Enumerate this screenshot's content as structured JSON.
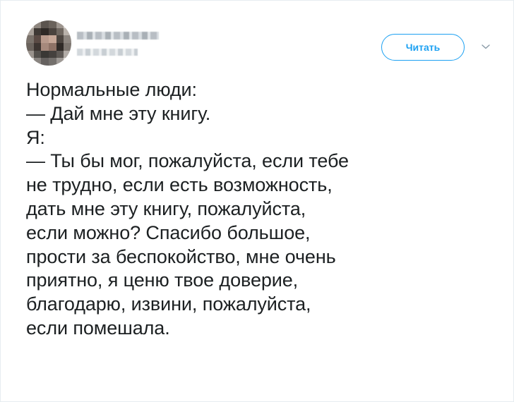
{
  "tweet": {
    "follow_label": "Читать",
    "text": "Нормальные люди:\n— Дай мне эту книгу.\nЯ:\n— Ты бы мог, пожалуйста, если тебе\nне трудно, если есть возможность,\nдать мне эту книгу, пожалуйста,\nесли можно? Спасибо большое,\nпрости за беспокойство, мне очень\nприятно, я ценю твое доверие,\nблагодарю, извини, пожалуйста,\nесли помешала."
  },
  "icons": {
    "avatar": "avatar-pixelated",
    "menu": "chevron-down-icon"
  },
  "colors": {
    "accent": "#1da1f2",
    "text": "#1c2022",
    "border": "#e6ecf0"
  }
}
